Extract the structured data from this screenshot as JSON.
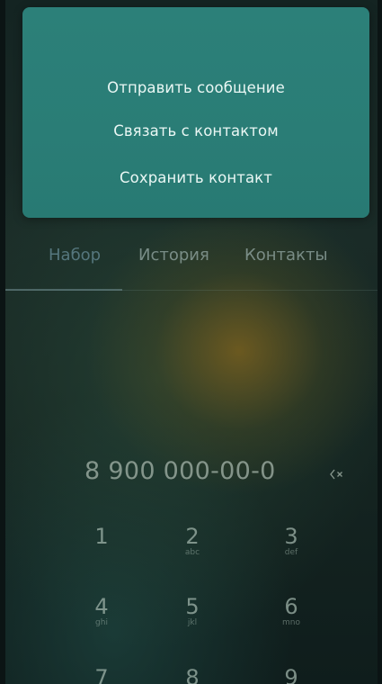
{
  "context_menu": {
    "items": [
      {
        "label": "Отправить сообщение"
      },
      {
        "label": "Связать с контактом"
      },
      {
        "label": "Сохранить контакт"
      }
    ]
  },
  "tabs": [
    {
      "label": "Набор",
      "active": true
    },
    {
      "label": "История",
      "active": false
    },
    {
      "label": "Контакты",
      "active": false
    }
  ],
  "dialer": {
    "number": "8 900 000-00-0",
    "backspace_icon": "backspace-icon",
    "keys": [
      {
        "digit": "1",
        "letters": ""
      },
      {
        "digit": "2",
        "letters": "abc"
      },
      {
        "digit": "3",
        "letters": "def"
      },
      {
        "digit": "4",
        "letters": "ghi"
      },
      {
        "digit": "5",
        "letters": "jkl"
      },
      {
        "digit": "6",
        "letters": "mno"
      },
      {
        "digit": "7",
        "letters": ""
      },
      {
        "digit": "8",
        "letters": ""
      },
      {
        "digit": "9",
        "letters": ""
      }
    ]
  },
  "colors": {
    "menu_background": "#2a7d76",
    "menu_text": "#eaf7f4",
    "accent_glow": "#7a5f1e"
  }
}
